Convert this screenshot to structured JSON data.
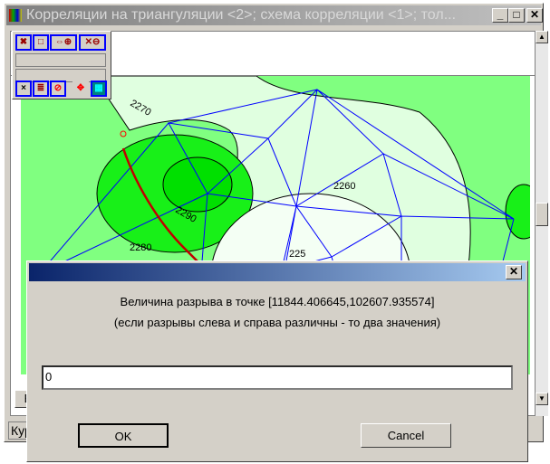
{
  "window": {
    "title": "Корреляции на триангуляции <2>; схема корреляции <1>; тол...",
    "minimize": "_",
    "maximize": "□",
    "close": "✕"
  },
  "status": {
    "text": "Кур",
    "button": "В"
  },
  "map": {
    "labels": [
      "2270",
      "2260",
      "2290",
      "2280",
      "225"
    ],
    "colors": {
      "light": "#e0ffe0",
      "mid": "#80ff80",
      "dark": "#18f018",
      "darker": "#00e000",
      "edges": "#0000ff",
      "well": "#c00000"
    }
  },
  "dialog": {
    "close": "✕",
    "line1": "Величина разрыва в точке [11844.406645,102607.935574]",
    "line2": "(если разрывы слева и справа различны - то два значения)",
    "input_value": "0",
    "ok": "OK",
    "cancel": "Cancel"
  }
}
